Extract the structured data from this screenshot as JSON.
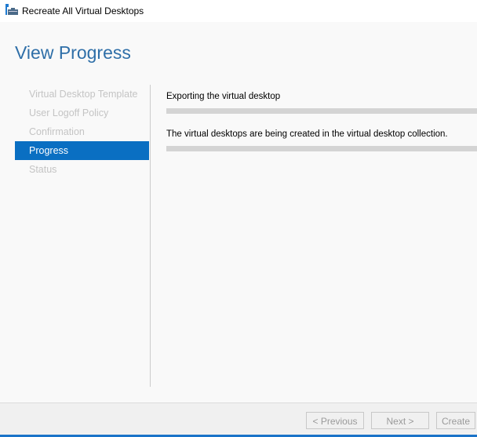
{
  "window": {
    "title": "Recreate All Virtual Desktops",
    "icon": "server-collection-icon"
  },
  "page": {
    "heading": "View Progress"
  },
  "nav": {
    "items": [
      {
        "label": "Virtual Desktop Template",
        "active": false
      },
      {
        "label": "User Logoff Policy",
        "active": false
      },
      {
        "label": "Confirmation",
        "active": false
      },
      {
        "label": "Progress",
        "active": true
      },
      {
        "label": "Status",
        "active": false
      }
    ]
  },
  "main": {
    "steps": [
      {
        "label": "Exporting the virtual desktop",
        "progress": 0
      },
      {
        "label": "The virtual desktops are being created in the virtual desktop collection.",
        "progress": 0
      }
    ]
  },
  "footer": {
    "previous": "< Previous",
    "next": "Next >",
    "create": "Create"
  },
  "colors": {
    "accent": "#0a6fc2",
    "heading": "#2f6fa8"
  }
}
